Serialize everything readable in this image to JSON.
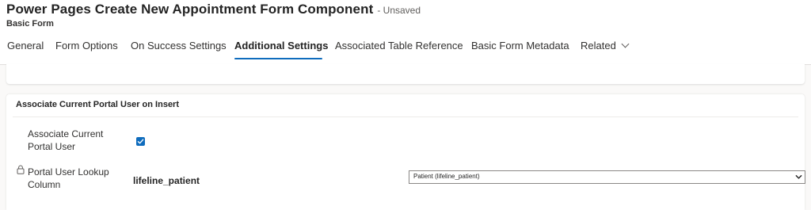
{
  "header": {
    "title": "Power Pages Create New Appointment Form Component",
    "status": "- Unsaved",
    "subtitle": "Basic Form"
  },
  "tabs": [
    {
      "label": "General"
    },
    {
      "label": "Form Options"
    },
    {
      "label": "On Success Settings"
    },
    {
      "label": "Additional Settings",
      "active": true
    },
    {
      "label": "Associated Table Reference"
    },
    {
      "label": "Basic Form Metadata"
    },
    {
      "label": "Related"
    }
  ],
  "section": {
    "title": "Associate Current Portal User on Insert",
    "fields": [
      {
        "label": "Associate Current Portal User",
        "checked": true
      },
      {
        "label": "Portal User Lookup Column",
        "value": "lifeline_patient",
        "select_value": "Patient (lifeline_patient)"
      }
    ]
  },
  "colors": {
    "accent": "#0f6cbd",
    "background": "#faf9f8",
    "card": "#ffffff"
  },
  "icons": [
    "lock-icon",
    "chevron-down-icon",
    "checkmark-icon"
  ]
}
